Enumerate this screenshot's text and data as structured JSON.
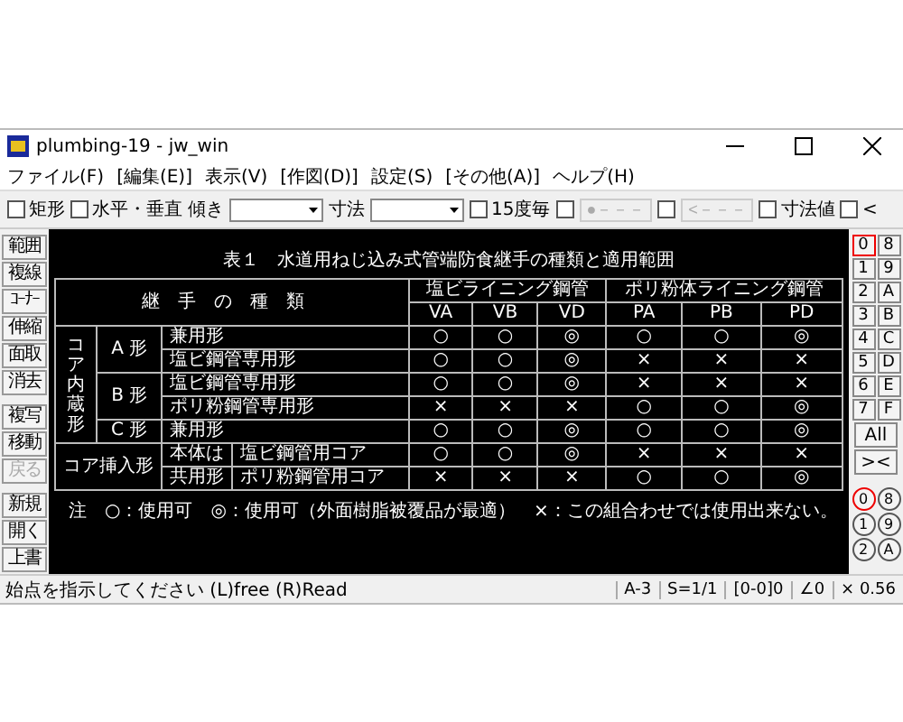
{
  "window": {
    "title": "plumbing-19 - jw_win"
  },
  "menu": [
    "ファイル(F)",
    "[編集(E)]",
    "表示(V)",
    "[作図(D)]",
    "設定(S)",
    "[その他(A)]",
    "ヘルプ(H)"
  ],
  "toolbar": [
    {
      "kind": "checkbox",
      "label": "矩形",
      "checked": false
    },
    {
      "kind": "checkbox",
      "label": "水平・垂直",
      "checked": false
    },
    {
      "kind": "label",
      "label": "傾き"
    },
    {
      "kind": "combo"
    },
    {
      "kind": "label",
      "label": "寸法"
    },
    {
      "kind": "combo"
    },
    {
      "kind": "checkbox",
      "label": "15度毎",
      "checked": false
    },
    {
      "kind": "checkbox",
      "checked": false
    },
    {
      "kind": "button",
      "label": "●－－－",
      "disabled": true
    },
    {
      "kind": "checkbox",
      "checked": false
    },
    {
      "kind": "button",
      "label": "<－－－",
      "disabled": true
    },
    {
      "kind": "checkbox",
      "label": "寸法値",
      "checked": false
    },
    {
      "kind": "checkbox",
      "label": "<",
      "checked": false
    }
  ],
  "tools": [
    {
      "label": "範囲",
      "disabled": false
    },
    {
      "label": "複線",
      "disabled": false
    },
    {
      "label": "ｺｰﾅｰ",
      "disabled": false
    },
    {
      "label": "伸縮",
      "disabled": false
    },
    {
      "label": "面取",
      "disabled": false
    },
    {
      "label": "消去",
      "disabled": false
    },
    {
      "label": "複写",
      "disabled": false
    },
    {
      "label": "移動",
      "disabled": false
    },
    {
      "label": "戻る",
      "disabled": true
    },
    {
      "label": "新規",
      "disabled": false
    },
    {
      "label": "開く",
      "disabled": false
    },
    {
      "label": "上書",
      "disabled": false
    }
  ],
  "drawing": {
    "title": "表１　水道用ねじ込み式管端防食継手の種類と適用範囲",
    "type_heading": "継手の種類",
    "column_groups": [
      {
        "label": "塩ビライニング鋼管",
        "columns": [
          "VA",
          "VB",
          "VD"
        ]
      },
      {
        "label": "ポリ粉体ライニング鋼管",
        "columns": [
          "PA",
          "PB",
          "PD"
        ]
      }
    ],
    "groups": [
      {
        "kind": "vertical",
        "label": "コア内蔵形",
        "subgroups": [
          {
            "label": "A 形",
            "rows": [
              {
                "type": "兼用形",
                "values": [
                  "○",
                  "○",
                  "◎",
                  "○",
                  "○",
                  "◎"
                ]
              },
              {
                "type": "塩ビ鋼管専用形",
                "values": [
                  "○",
                  "○",
                  "◎",
                  "×",
                  "×",
                  "×"
                ]
              }
            ]
          },
          {
            "label": "B 形",
            "rows": [
              {
                "type": "塩ビ鋼管専用形",
                "values": [
                  "○",
                  "○",
                  "◎",
                  "×",
                  "×",
                  "×"
                ]
              },
              {
                "type": "ポリ粉鋼管専用形",
                "values": [
                  "×",
                  "×",
                  "×",
                  "○",
                  "○",
                  "◎"
                ]
              }
            ]
          },
          {
            "label": "C 形",
            "rows": [
              {
                "type": "兼用形",
                "values": [
                  "○",
                  "○",
                  "◎",
                  "○",
                  "○",
                  "◎"
                ]
              }
            ]
          }
        ]
      },
      {
        "kind": "wide",
        "label": "コア挿入形",
        "subgroups": [
          {
            "label": "本体は",
            "rows": [
              {
                "type": "塩ビ鋼管用コア",
                "values": [
                  "○",
                  "○",
                  "◎",
                  "×",
                  "×",
                  "×"
                ]
              }
            ]
          },
          {
            "label": "共用形",
            "rows": [
              {
                "type": "ポリ粉鋼管用コア",
                "values": [
                  "×",
                  "×",
                  "×",
                  "○",
                  "○",
                  "◎"
                ]
              }
            ]
          }
        ]
      }
    ],
    "note": "注　○：使用可　◎：使用可（外面樹脂被覆品が最適）　×：この組合わせでは使用出来ない。"
  },
  "layers": [
    {
      "label": "0",
      "selected": true
    },
    {
      "label": "8",
      "selected": false
    },
    {
      "label": "1",
      "selected": false
    },
    {
      "label": "9",
      "selected": false
    },
    {
      "label": "2",
      "selected": false
    },
    {
      "label": "A",
      "selected": false
    },
    {
      "label": "3",
      "selected": false
    },
    {
      "label": "B",
      "selected": false
    },
    {
      "label": "4",
      "selected": false
    },
    {
      "label": "C",
      "selected": false
    },
    {
      "label": "5",
      "selected": false
    },
    {
      "label": "D",
      "selected": false
    },
    {
      "label": "6",
      "selected": false
    },
    {
      "label": "E",
      "selected": false
    },
    {
      "label": "7",
      "selected": false
    },
    {
      "label": "F",
      "selected": false
    }
  ],
  "layer_buttons": [
    "All",
    "><"
  ],
  "layer_groups": [
    {
      "label": "0",
      "selected": true
    },
    {
      "label": "8",
      "selected": false
    },
    {
      "label": "1",
      "selected": false
    },
    {
      "label": "9",
      "selected": false
    },
    {
      "label": "2",
      "selected": false
    },
    {
      "label": "A",
      "selected": false
    }
  ],
  "status_bar": {
    "message": "始点を指示してください (L)free (R)Read",
    "fields": [
      "A-3",
      "S=1/1",
      "[0-0]0",
      "∠0",
      "× 0.56"
    ]
  }
}
